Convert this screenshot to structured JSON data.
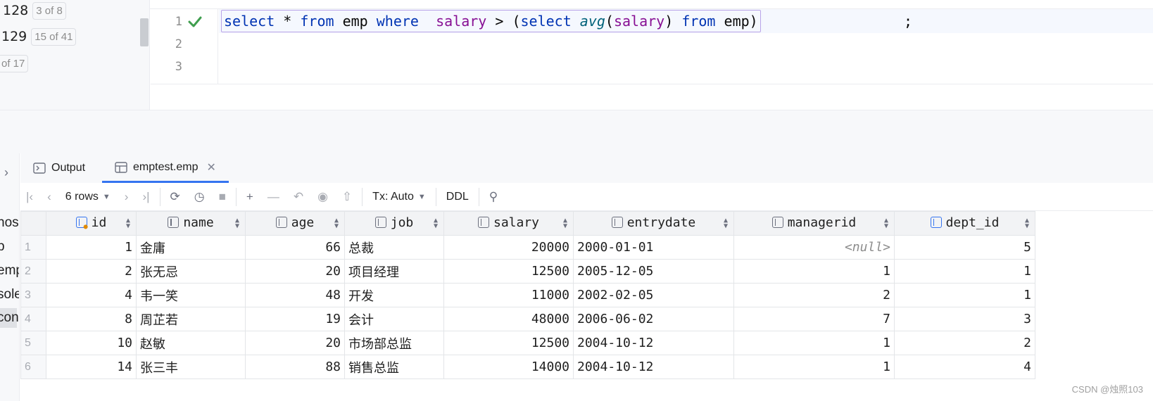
{
  "left_panel": {
    "rows": [
      {
        "num": "128",
        "badge": "3 of 8"
      },
      {
        "num": "129",
        "badge": "15 of 41"
      },
      {
        "num": "",
        "badge": "of 17"
      }
    ]
  },
  "editor": {
    "line_numbers": [
      "1",
      "2",
      "3"
    ],
    "status_icon": "check-icon",
    "sql_tokens": [
      {
        "text": "select",
        "cls": "kw"
      },
      {
        "text": " * ",
        "cls": "plain"
      },
      {
        "text": "from",
        "cls": "kw"
      },
      {
        "text": " emp ",
        "cls": "plain"
      },
      {
        "text": "where",
        "cls": "kw"
      },
      {
        "text": "  ",
        "cls": "plain"
      },
      {
        "text": "salary",
        "cls": "col"
      },
      {
        "text": " > (",
        "cls": "plain"
      },
      {
        "text": "select",
        "cls": "kw"
      },
      {
        "text": " ",
        "cls": "plain"
      },
      {
        "text": "avg",
        "cls": "fn"
      },
      {
        "text": "(",
        "cls": "plain"
      },
      {
        "text": "salary",
        "cls": "col"
      },
      {
        "text": ") ",
        "cls": "plain"
      },
      {
        "text": "from",
        "cls": "kw"
      },
      {
        "text": " emp)",
        "cls": "plain"
      }
    ],
    "semicolon": ";"
  },
  "side_strip": {
    "items": [
      "hos",
      "p",
      "emp",
      "sole",
      "cons"
    ]
  },
  "tabs": [
    {
      "label": "Output",
      "icon": "console-icon"
    },
    {
      "label": "emptest.emp",
      "icon": "table-icon",
      "close": "✕"
    }
  ],
  "toolbar": {
    "rows_label": "6 rows",
    "tx_label": "Tx: Auto",
    "ddl_label": "DDL"
  },
  "grid": {
    "columns": [
      "id",
      "name",
      "age",
      "job",
      "salary",
      "entrydate",
      "managerid",
      "dept_id"
    ],
    "rows": [
      {
        "rn": "1",
        "id": "1",
        "name": "金庸",
        "age": "66",
        "job": "总裁",
        "salary": "20000",
        "entrydate": "2000-01-01",
        "managerid": "<null>",
        "dept_id": "5"
      },
      {
        "rn": "2",
        "id": "2",
        "name": "张无忌",
        "age": "20",
        "job": "项目经理",
        "salary": "12500",
        "entrydate": "2005-12-05",
        "managerid": "1",
        "dept_id": "1"
      },
      {
        "rn": "3",
        "id": "4",
        "name": "韦一笑",
        "age": "48",
        "job": "开发",
        "salary": "11000",
        "entrydate": "2002-02-05",
        "managerid": "2",
        "dept_id": "1"
      },
      {
        "rn": "4",
        "id": "8",
        "name": "周芷若",
        "age": "19",
        "job": "会计",
        "salary": "48000",
        "entrydate": "2006-06-02",
        "managerid": "7",
        "dept_id": "3"
      },
      {
        "rn": "5",
        "id": "10",
        "name": "赵敏",
        "age": "20",
        "job": "市场部总监",
        "salary": "12500",
        "entrydate": "2004-10-12",
        "managerid": "1",
        "dept_id": "2"
      },
      {
        "rn": "6",
        "id": "14",
        "name": "张三丰",
        "age": "88",
        "job": "销售总监",
        "salary": "14000",
        "entrydate": "2004-10-12",
        "managerid": "1",
        "dept_id": "4"
      }
    ]
  },
  "watermark": "CSDN @烛照103"
}
